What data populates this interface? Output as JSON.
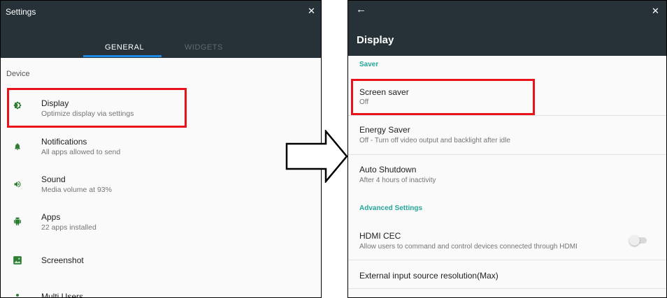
{
  "left": {
    "window_title": "Settings",
    "tabs": [
      "GENERAL",
      "WIDGETS"
    ],
    "active_tab": "GENERAL",
    "section": "Device",
    "items": [
      {
        "title": "Display",
        "subtitle": "Optimize display via settings",
        "icon": "brightness-icon",
        "highlighted": true
      },
      {
        "title": "Notifications",
        "subtitle": "All apps allowed to send",
        "icon": "bell-icon"
      },
      {
        "title": "Sound",
        "subtitle": "Media volume at 93%",
        "icon": "speaker-icon"
      },
      {
        "title": "Apps",
        "subtitle": "22 apps installed",
        "icon": "android-icon"
      },
      {
        "title": "Screenshot",
        "subtitle": "",
        "icon": "image-icon"
      },
      {
        "title": "Multi Users",
        "subtitle": "",
        "icon": "person-icon"
      }
    ]
  },
  "right": {
    "page_title": "Display",
    "sections": [
      {
        "label": "Saver",
        "items": [
          {
            "title": "Screen saver",
            "subtitle": "Off",
            "highlighted": true
          },
          {
            "title": "Energy Saver",
            "subtitle": "Off - Turn off video output and backlight after idle"
          },
          {
            "title": "Auto Shutdown",
            "subtitle": "After 4 hours of inactivity"
          }
        ]
      },
      {
        "label": "Advanced Settings",
        "items": [
          {
            "title": "HDMI CEC",
            "subtitle": "Allow users to command and control devices connected through HDMI",
            "toggle": "off"
          },
          {
            "title": "External input source resolution(Max)",
            "subtitle": ""
          }
        ]
      }
    ]
  },
  "colors": {
    "header": "#263238",
    "accent": "#26a69a",
    "tab_indicator": "#1e88e5",
    "highlight": "#e8121b",
    "icon": "#2e7d32"
  }
}
